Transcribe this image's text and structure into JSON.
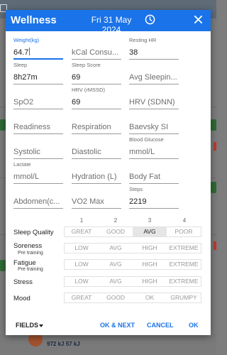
{
  "dialog": {
    "title": "Wellness",
    "date": "Fri 31 May 2024"
  },
  "background": {
    "summary_text": "972 kJ 57 kJ"
  },
  "fields": [
    {
      "label": "Weight(kg)",
      "value": "64.7",
      "placeholder": ""
    },
    {
      "label": "",
      "value": "",
      "placeholder": "kCal Consu..."
    },
    {
      "label": "Resting HR",
      "value": "38",
      "placeholder": ""
    },
    {
      "label": "Sleep",
      "value": "8h27m",
      "placeholder": ""
    },
    {
      "label": "Sleep Score",
      "value": "69",
      "placeholder": ""
    },
    {
      "label": "",
      "value": "",
      "placeholder": "Avg Sleepin..."
    },
    {
      "label": "",
      "value": "",
      "placeholder": "SpO2"
    },
    {
      "label": "HRV (rMSSD)",
      "value": "69",
      "placeholder": ""
    },
    {
      "label": "",
      "value": "",
      "placeholder": "HRV (SDNN)"
    },
    {
      "label": "",
      "value": "",
      "placeholder": "Readiness"
    },
    {
      "label": "",
      "value": "",
      "placeholder": "Respiration"
    },
    {
      "label": "",
      "value": "",
      "placeholder": "Baevsky SI"
    },
    {
      "label": "",
      "value": "",
      "placeholder": "Systolic"
    },
    {
      "label": "",
      "value": "",
      "placeholder": "Diastolic"
    },
    {
      "label": "Blood Glucose",
      "value": "",
      "placeholder": "mmol/L"
    },
    {
      "label": "Lactate",
      "value": "",
      "placeholder": "mmol/L"
    },
    {
      "label": "",
      "value": "",
      "placeholder": "Hydration (L)"
    },
    {
      "label": "",
      "value": "",
      "placeholder": "Body Fat"
    },
    {
      "label": "",
      "value": "",
      "placeholder": "Abdomen(c..."
    },
    {
      "label": "",
      "value": "",
      "placeholder": "VO2 Max"
    },
    {
      "label": "Steps",
      "value": "2219",
      "placeholder": ""
    }
  ],
  "column_numbers": [
    "1",
    "2",
    "3",
    "4"
  ],
  "ratings": [
    {
      "label": "Sleep Quality",
      "sub": "",
      "options": [
        "GREAT",
        "GOOD",
        "AVG",
        "POOR"
      ],
      "selected": "AVG"
    },
    {
      "label": "Soreness",
      "sub": "Pre training",
      "options": [
        "LOW",
        "AVG",
        "HIGH",
        "EXTREME"
      ],
      "selected": ""
    },
    {
      "label": "Fatigue",
      "sub": "Pre training",
      "options": [
        "LOW",
        "AVG",
        "HIGH",
        "EXTREME"
      ],
      "selected": ""
    },
    {
      "label": "Stress",
      "sub": "",
      "options": [
        "LOW",
        "AVG",
        "HIGH",
        "EXTREME"
      ],
      "selected": ""
    },
    {
      "label": "Mood",
      "sub": "",
      "options": [
        "GREAT",
        "GOOD",
        "OK",
        "GRUMPY"
      ],
      "selected": ""
    }
  ],
  "footer": {
    "fields_label": "FIELDS",
    "ok_next_label": "OK & NEXT",
    "cancel_label": "CANCEL",
    "ok_label": "OK"
  },
  "colors": {
    "accent": "#1a73e8",
    "selected_segment": "#e6e6e6"
  },
  "icons": [
    "clock-icon",
    "close-icon",
    "chevron-down-icon"
  ]
}
